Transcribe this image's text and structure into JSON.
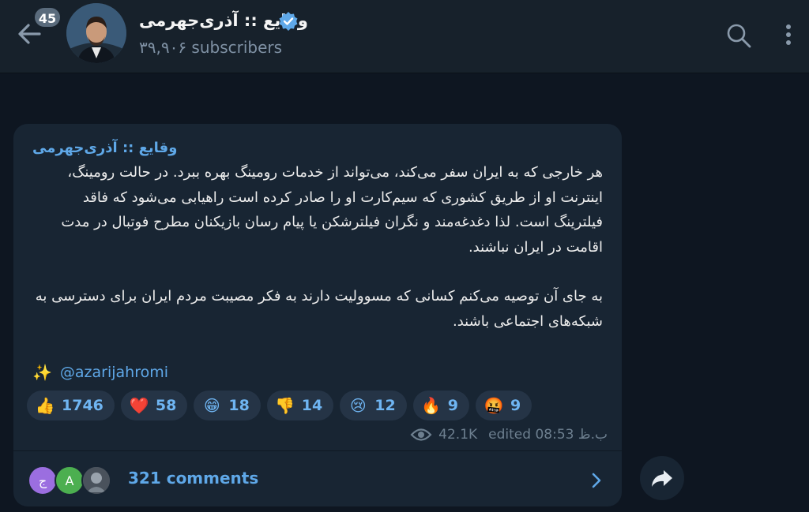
{
  "header": {
    "unread_count": "45",
    "channel_title": "وقایع :: آذری‌جهرمی",
    "subscribers": "۳۹,۹۰۶ subscribers"
  },
  "icons": {
    "back": "back-arrow-icon",
    "verified": "verified-badge-icon",
    "search": "search-icon",
    "more": "more-vertical-icon",
    "views": "eye-icon",
    "chevron": "chevron-right-icon",
    "share": "share-forward-icon"
  },
  "post": {
    "author": "وقایع :: آذری‌جهرمی",
    "paragraph1": "هر خارجی که به ایران سفر می‌کند، می‌تواند از خدمات رومینگ بهره ببرد. در حالت رومینگ، اینترنت او از طریق کشوری که سیم‌کارت او را صادر کرده است راهیابی می‌شود که فاقد فیلترینگ است. لذا دغدغه‌مند و نگران فیلترشکن یا پیام رسان بازیکنان مطرح فوتبال در مدت اقامت در ایران نباشند.",
    "paragraph2": "به جای آن توصیه می‌کنم کسانی که مسوولیت دارند به فکر مصیبت مردم ایران برای دسترسی به شبکه‌های اجتماعی باشند.",
    "signature_emoji": "✨",
    "signature": "@azarijahromi",
    "reactions": [
      {
        "emoji": "👍",
        "count": "1746"
      },
      {
        "emoji": "❤️",
        "count": "58"
      },
      {
        "emoji": "😁",
        "count": "18"
      },
      {
        "emoji": "👎",
        "count": "14"
      },
      {
        "emoji": "😢",
        "count": "12"
      },
      {
        "emoji": "🔥",
        "count": "9"
      },
      {
        "emoji": "🤬",
        "count": "9"
      }
    ],
    "views": "42.1K",
    "edited_time": "edited 08:53 ب.ظ"
  },
  "comments": {
    "avatars": [
      {
        "label": "ج",
        "color": "#9b6ee0"
      },
      {
        "label": "A",
        "color": "#4caf50"
      },
      {
        "label": "",
        "color": "#5b6470"
      }
    ],
    "label": "321 comments"
  },
  "colors": {
    "background": "#0e1621",
    "header": "#17212b",
    "bubble": "#182533",
    "accent": "#5fa8e8",
    "reaction_bg": "#253446"
  }
}
